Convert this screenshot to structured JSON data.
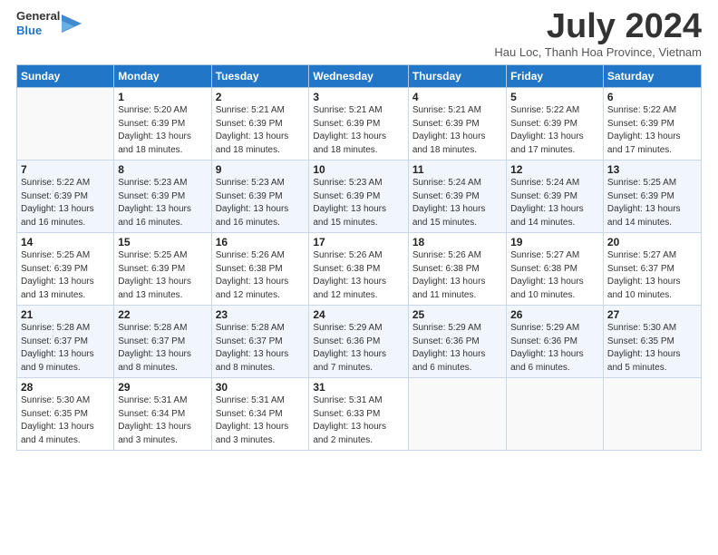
{
  "header": {
    "logo_line1": "General",
    "logo_line2": "Blue",
    "month": "July 2024",
    "location": "Hau Loc, Thanh Hoa Province, Vietnam"
  },
  "days_of_week": [
    "Sunday",
    "Monday",
    "Tuesday",
    "Wednesday",
    "Thursday",
    "Friday",
    "Saturday"
  ],
  "weeks": [
    [
      {
        "day": "",
        "info": []
      },
      {
        "day": "1",
        "info": [
          "Sunrise: 5:20 AM",
          "Sunset: 6:39 PM",
          "Daylight: 13 hours",
          "and 18 minutes."
        ]
      },
      {
        "day": "2",
        "info": [
          "Sunrise: 5:21 AM",
          "Sunset: 6:39 PM",
          "Daylight: 13 hours",
          "and 18 minutes."
        ]
      },
      {
        "day": "3",
        "info": [
          "Sunrise: 5:21 AM",
          "Sunset: 6:39 PM",
          "Daylight: 13 hours",
          "and 18 minutes."
        ]
      },
      {
        "day": "4",
        "info": [
          "Sunrise: 5:21 AM",
          "Sunset: 6:39 PM",
          "Daylight: 13 hours",
          "and 18 minutes."
        ]
      },
      {
        "day": "5",
        "info": [
          "Sunrise: 5:22 AM",
          "Sunset: 6:39 PM",
          "Daylight: 13 hours",
          "and 17 minutes."
        ]
      },
      {
        "day": "6",
        "info": [
          "Sunrise: 5:22 AM",
          "Sunset: 6:39 PM",
          "Daylight: 13 hours",
          "and 17 minutes."
        ]
      }
    ],
    [
      {
        "day": "7",
        "info": [
          "Sunrise: 5:22 AM",
          "Sunset: 6:39 PM",
          "Daylight: 13 hours",
          "and 16 minutes."
        ]
      },
      {
        "day": "8",
        "info": [
          "Sunrise: 5:23 AM",
          "Sunset: 6:39 PM",
          "Daylight: 13 hours",
          "and 16 minutes."
        ]
      },
      {
        "day": "9",
        "info": [
          "Sunrise: 5:23 AM",
          "Sunset: 6:39 PM",
          "Daylight: 13 hours",
          "and 16 minutes."
        ]
      },
      {
        "day": "10",
        "info": [
          "Sunrise: 5:23 AM",
          "Sunset: 6:39 PM",
          "Daylight: 13 hours",
          "and 15 minutes."
        ]
      },
      {
        "day": "11",
        "info": [
          "Sunrise: 5:24 AM",
          "Sunset: 6:39 PM",
          "Daylight: 13 hours",
          "and 15 minutes."
        ]
      },
      {
        "day": "12",
        "info": [
          "Sunrise: 5:24 AM",
          "Sunset: 6:39 PM",
          "Daylight: 13 hours",
          "and 14 minutes."
        ]
      },
      {
        "day": "13",
        "info": [
          "Sunrise: 5:25 AM",
          "Sunset: 6:39 PM",
          "Daylight: 13 hours",
          "and 14 minutes."
        ]
      }
    ],
    [
      {
        "day": "14",
        "info": [
          "Sunrise: 5:25 AM",
          "Sunset: 6:39 PM",
          "Daylight: 13 hours",
          "and 13 minutes."
        ]
      },
      {
        "day": "15",
        "info": [
          "Sunrise: 5:25 AM",
          "Sunset: 6:39 PM",
          "Daylight: 13 hours",
          "and 13 minutes."
        ]
      },
      {
        "day": "16",
        "info": [
          "Sunrise: 5:26 AM",
          "Sunset: 6:38 PM",
          "Daylight: 13 hours",
          "and 12 minutes."
        ]
      },
      {
        "day": "17",
        "info": [
          "Sunrise: 5:26 AM",
          "Sunset: 6:38 PM",
          "Daylight: 13 hours",
          "and 12 minutes."
        ]
      },
      {
        "day": "18",
        "info": [
          "Sunrise: 5:26 AM",
          "Sunset: 6:38 PM",
          "Daylight: 13 hours",
          "and 11 minutes."
        ]
      },
      {
        "day": "19",
        "info": [
          "Sunrise: 5:27 AM",
          "Sunset: 6:38 PM",
          "Daylight: 13 hours",
          "and 10 minutes."
        ]
      },
      {
        "day": "20",
        "info": [
          "Sunrise: 5:27 AM",
          "Sunset: 6:37 PM",
          "Daylight: 13 hours",
          "and 10 minutes."
        ]
      }
    ],
    [
      {
        "day": "21",
        "info": [
          "Sunrise: 5:28 AM",
          "Sunset: 6:37 PM",
          "Daylight: 13 hours",
          "and 9 minutes."
        ]
      },
      {
        "day": "22",
        "info": [
          "Sunrise: 5:28 AM",
          "Sunset: 6:37 PM",
          "Daylight: 13 hours",
          "and 8 minutes."
        ]
      },
      {
        "day": "23",
        "info": [
          "Sunrise: 5:28 AM",
          "Sunset: 6:37 PM",
          "Daylight: 13 hours",
          "and 8 minutes."
        ]
      },
      {
        "day": "24",
        "info": [
          "Sunrise: 5:29 AM",
          "Sunset: 6:36 PM",
          "Daylight: 13 hours",
          "and 7 minutes."
        ]
      },
      {
        "day": "25",
        "info": [
          "Sunrise: 5:29 AM",
          "Sunset: 6:36 PM",
          "Daylight: 13 hours",
          "and 6 minutes."
        ]
      },
      {
        "day": "26",
        "info": [
          "Sunrise: 5:29 AM",
          "Sunset: 6:36 PM",
          "Daylight: 13 hours",
          "and 6 minutes."
        ]
      },
      {
        "day": "27",
        "info": [
          "Sunrise: 5:30 AM",
          "Sunset: 6:35 PM",
          "Daylight: 13 hours",
          "and 5 minutes."
        ]
      }
    ],
    [
      {
        "day": "28",
        "info": [
          "Sunrise: 5:30 AM",
          "Sunset: 6:35 PM",
          "Daylight: 13 hours",
          "and 4 minutes."
        ]
      },
      {
        "day": "29",
        "info": [
          "Sunrise: 5:31 AM",
          "Sunset: 6:34 PM",
          "Daylight: 13 hours",
          "and 3 minutes."
        ]
      },
      {
        "day": "30",
        "info": [
          "Sunrise: 5:31 AM",
          "Sunset: 6:34 PM",
          "Daylight: 13 hours",
          "and 3 minutes."
        ]
      },
      {
        "day": "31",
        "info": [
          "Sunrise: 5:31 AM",
          "Sunset: 6:33 PM",
          "Daylight: 13 hours",
          "and 2 minutes."
        ]
      },
      {
        "day": "",
        "info": []
      },
      {
        "day": "",
        "info": []
      },
      {
        "day": "",
        "info": []
      }
    ]
  ]
}
